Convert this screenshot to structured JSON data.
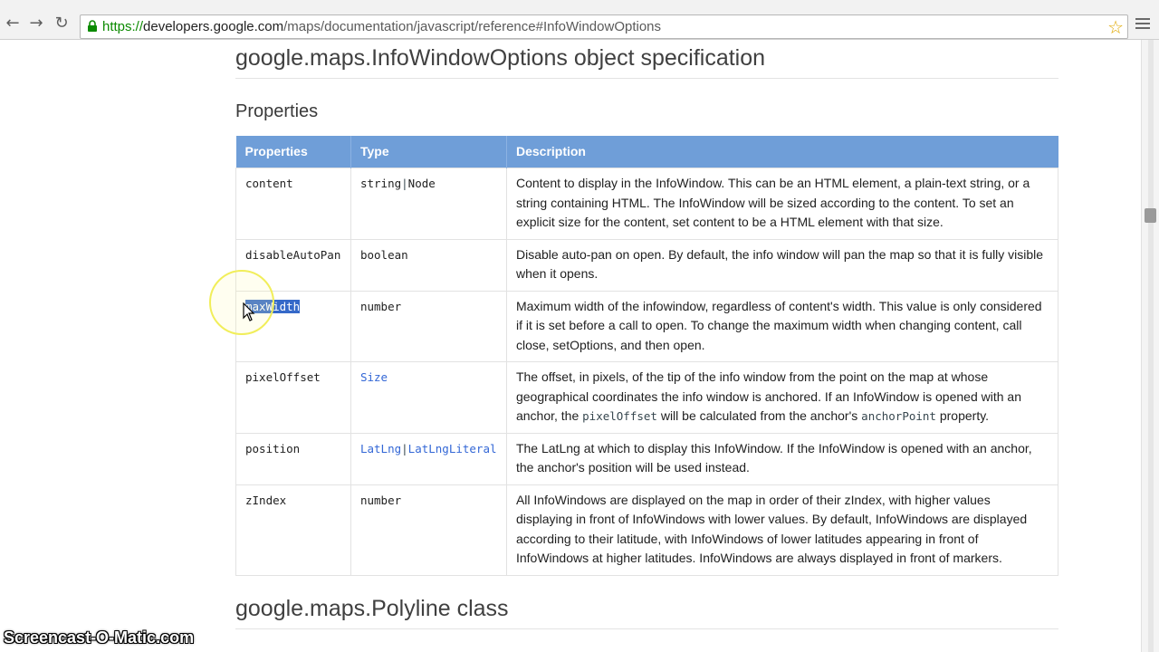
{
  "browser": {
    "url_secure_part": "https://",
    "url_domain": "developers.google.com",
    "url_path": "/maps/documentation/javascript/reference#InfoWindowOptions"
  },
  "page": {
    "spec_heading": "google.maps.InfoWindowOptions object specification",
    "properties_heading": "Properties",
    "next_heading": "google.maps.Polyline class"
  },
  "table": {
    "headers": [
      "Properties",
      "Type",
      "Description"
    ],
    "rows": [
      {
        "name": "content",
        "type_parts": [
          "string",
          "|",
          "Node"
        ],
        "description": "Content to display in the InfoWindow. This can be an HTML element, a plain-text string, or a string containing HTML. The InfoWindow will be sized according to the content. To set an explicit size for the content, set content to be a HTML element with that size."
      },
      {
        "name": "disableAutoPan",
        "type_parts": [
          "boolean"
        ],
        "description": "Disable auto-pan on open. By default, the info window will pan the map so that it is fully visible when it opens."
      },
      {
        "name": "maxWidth",
        "type_parts": [
          "number"
        ],
        "description": "Maximum width of the infowindow, regardless of content's width. This value is only considered if it is set before a call to open. To change the maximum width when changing content, call close, setOptions, and then open."
      },
      {
        "name": "pixelOffset",
        "type_parts": [
          "Size"
        ],
        "description_a": "The offset, in pixels, of the tip of the info window from the point on the map at whose geographical coordinates the info window is anchored. If an InfoWindow is opened with an anchor, the ",
        "code_a": "pixelOffset",
        "description_b": " will be calculated from the anchor's ",
        "code_b": "anchorPoint",
        "description_c": " property."
      },
      {
        "name": "position",
        "type_parts": [
          "LatLng",
          "|",
          "LatLngLiteral"
        ],
        "description": "The LatLng at which to display this InfoWindow. If the InfoWindow is opened with an anchor, the anchor's position will be used instead."
      },
      {
        "name": "zIndex",
        "type_parts": [
          "number"
        ],
        "description": "All InfoWindows are displayed on the map in order of their zIndex, with higher values displaying in front of InfoWindows with lower values. By default, InfoWindows are displayed according to their latitude, with InfoWindows of lower latitudes appearing in front of InfoWindows at higher latitudes. InfoWindows are always displayed in front of markers."
      }
    ]
  },
  "watermark": "Screencast-O-Matic.com",
  "colors": {
    "header_bg": "#6f9ed8",
    "selection": "#3569c9",
    "link": "#3367d6",
    "secure_green": "#0b8a00"
  }
}
